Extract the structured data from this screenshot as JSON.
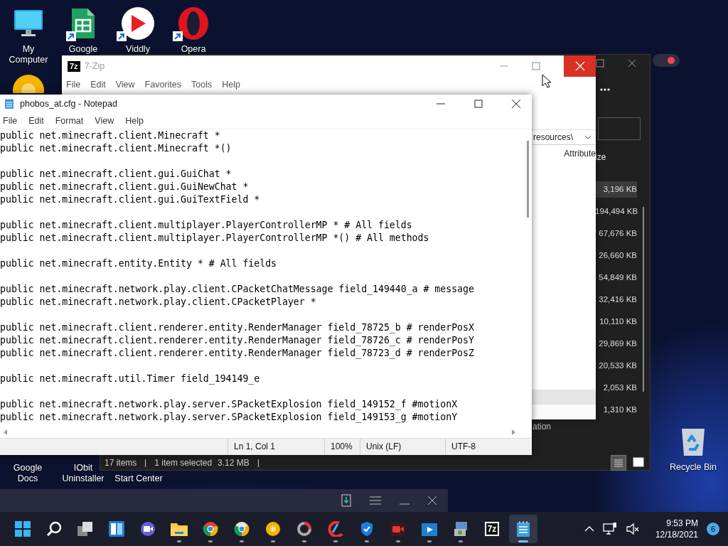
{
  "desktop_icons": [
    {
      "kind": "computer",
      "label": "My Computer"
    },
    {
      "kind": "sheets",
      "label": "Google",
      "shortcut": true
    },
    {
      "kind": "viddly",
      "label": "Viddly",
      "shortcut": true
    },
    {
      "kind": "opera",
      "label": "Opera",
      "shortcut": true
    },
    {
      "kind": "canary"
    },
    {
      "kind": "docs",
      "label": "Google Docs"
    },
    {
      "kind": "iobit",
      "label": "IObit Uninstaller"
    },
    {
      "kind": "startcenter",
      "label": "Start Center"
    },
    {
      "kind": "recycle",
      "label": "Recycle Bin"
    }
  ],
  "file_manager": {
    "column_header": "ize",
    "sizes": [
      {
        "text": "3,196 KB",
        "selected": true
      },
      {
        "text": "194,494 KB",
        "selected": false
      },
      {
        "text": "67,676 KB",
        "selected": false
      },
      {
        "text": "26,660 KB",
        "selected": false
      },
      {
        "text": "54,849 KB",
        "selected": false
      },
      {
        "text": "32,416 KB",
        "selected": false
      },
      {
        "text": "10,110 KB",
        "selected": false
      },
      {
        "text": "29,869 KB",
        "selected": false
      },
      {
        "text": "20,533 KB",
        "selected": false
      },
      {
        "text": "2,053 KB",
        "selected": false
      },
      {
        "text": "1,310 KB",
        "selected": false
      }
    ],
    "partial_label": "ation",
    "status": {
      "items": "17 items",
      "selection": "1 item selected",
      "size": "3.12 MB"
    },
    "views": [
      {
        "kind": "details",
        "selected": true
      },
      {
        "kind": "preview",
        "selected": false
      }
    ]
  },
  "sevenzip": {
    "icon_label": "7z",
    "title": "7-Zip",
    "menu": [
      "File",
      "Edit",
      "View",
      "Favorites",
      "Tools",
      "Help"
    ],
    "path": "resources\\",
    "column": "Attribute"
  },
  "notepad": {
    "title": "phobos_at.cfg - Notepad",
    "menu": [
      "File",
      "Edit",
      "Format",
      "View",
      "Help"
    ],
    "blocks": [
      [
        "public net.minecraft.client.Minecraft *",
        "public net.minecraft.client.Minecraft *()"
      ],
      [
        "public net.minecraft.client.gui.GuiChat *",
        "public net.minecraft.client.gui.GuiNewChat *",
        "public net.minecraft.client.gui.GuiTextField *"
      ],
      [
        "public net.minecraft.client.multiplayer.PlayerControllerMP * # All fields",
        "public net.minecraft.client.multiplayer.PlayerControllerMP *() # All methods"
      ],
      [
        "public net.minecraft.entity.Entity * # All fields"
      ],
      [
        "public net.minecraft.network.play.client.CPacketChatMessage field_149440_a # message",
        "public net.minecraft.network.play.client.CPacketPlayer *"
      ],
      [
        "public net.minecraft.client.renderer.entity.RenderManager field_78725_b # renderPosX",
        "public net.minecraft.client.renderer.entity.RenderManager field_78726_c # renderPosY",
        "public net.minecraft.client.renderer.entity.RenderManager field_78723_d # renderPosZ"
      ],
      [
        "public net.minecraft.util.Timer field_194149_e"
      ],
      [
        "public net.minecraft.network.play.server.SPacketExplosion field_149152_f #motionX",
        "public net.minecraft.network.play.server.SPacketExplosion field_149153_g #motionY"
      ]
    ],
    "status": {
      "position": "Ln 1, Col 1",
      "zoom": "100%",
      "line_ending": "Unix (LF)",
      "encoding": "UTF-8"
    }
  },
  "taskbar": {
    "apps": [
      {
        "kind": "start",
        "selected": false
      },
      {
        "kind": "search",
        "selected": false
      },
      {
        "kind": "taskview",
        "selected": false
      },
      {
        "kind": "widgets",
        "selected": false
      },
      {
        "kind": "chat",
        "selected": false
      },
      {
        "kind": "explorer",
        "running": true,
        "selected": false
      },
      {
        "kind": "chrome",
        "running": true,
        "selected": false
      },
      {
        "kind": "chromedev",
        "running": true,
        "selected": false
      },
      {
        "kind": "canary",
        "running": true,
        "selected": false
      },
      {
        "kind": "ring",
        "running": true,
        "selected": false
      },
      {
        "kind": "brush",
        "running": true,
        "selected": false
      },
      {
        "kind": "shield",
        "running": true,
        "selected": false
      },
      {
        "kind": "recorder",
        "running": true,
        "selected": false
      },
      {
        "kind": "player",
        "running": true,
        "selected": false
      },
      {
        "kind": "installer",
        "running": true,
        "selected": false
      },
      {
        "kind": "sevenzip",
        "label": "7z",
        "selected": false
      },
      {
        "kind": "notepad",
        "running": true,
        "selected": true
      }
    ],
    "time": "9:53 PM",
    "date": "12/18/2021",
    "notifications": "6"
  }
}
